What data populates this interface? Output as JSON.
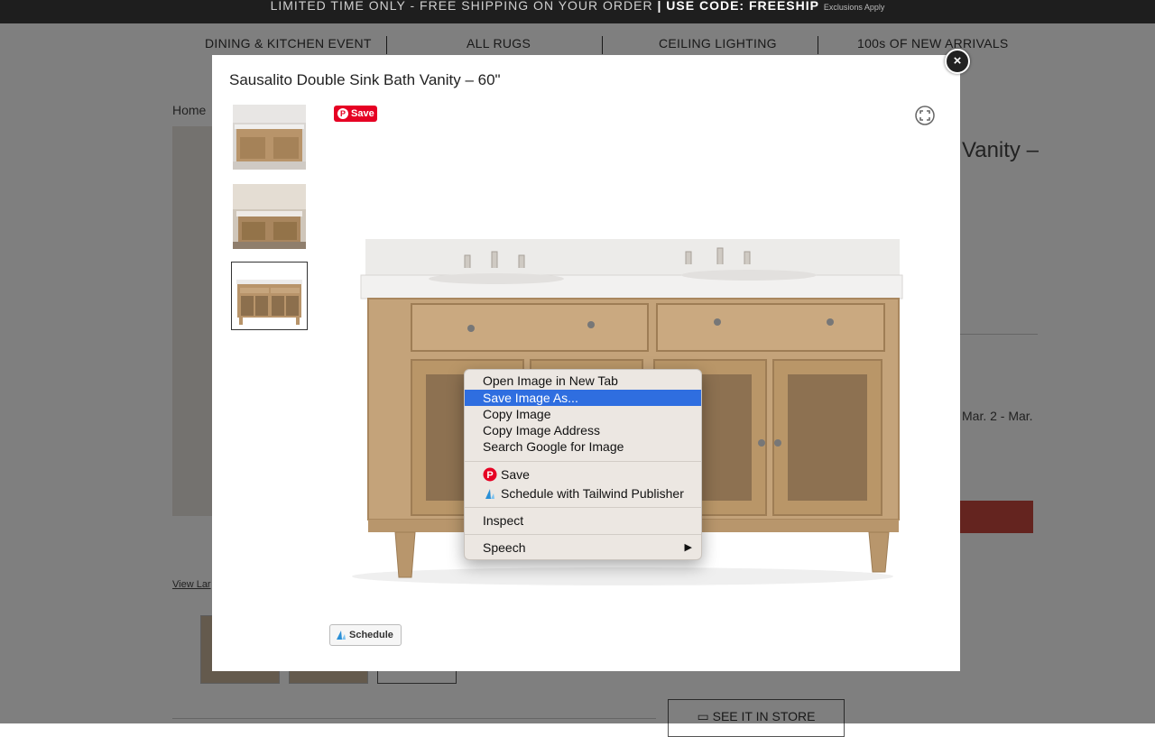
{
  "promo": {
    "text": "LIMITED TIME ONLY - FREE SHIPPING ON YOUR ORDER",
    "code": "| USE CODE: FREESHIP",
    "note": "Exclusions Apply"
  },
  "nav": {
    "items": [
      {
        "label": "DINING & KITCHEN EVENT"
      },
      {
        "label": "ALL RUGS"
      },
      {
        "label": "CEILING LIGHTING"
      },
      {
        "label": "100s OF NEW ARRIVALS"
      }
    ]
  },
  "page": {
    "breadcrumb_home": "Home",
    "title_fragment": "Vanity –",
    "delivery_fragment": "Mar. 2 - Mar.",
    "view_larger": "View Lar",
    "see_in_store": "SEE IT IN STORE"
  },
  "modal": {
    "title": "Sausalito Double Sink Bath Vanity – 60\"",
    "pin_save_label": "Save",
    "pin_glyph": "P",
    "schedule_label": "Schedule",
    "close_glyph": "×"
  },
  "context_menu": {
    "items": [
      {
        "label": "Open Image in New Tab"
      },
      {
        "label": "Save Image As..."
      },
      {
        "label": "Copy Image"
      },
      {
        "label": "Copy Image Address"
      },
      {
        "label": "Search Google for Image"
      },
      {
        "label": "Save"
      },
      {
        "label": "Schedule with Tailwind Publisher"
      },
      {
        "label": "Inspect"
      },
      {
        "label": "Speech"
      }
    ],
    "submenu_arrow": "▶",
    "highlighted_index": 1,
    "highlight_color": "#2f6ee0"
  },
  "icons": {
    "pinterest": "pinterest-icon",
    "tailwind": "tailwind-icon",
    "fullscreen": "fullscreen-icon",
    "close": "close-icon"
  },
  "colors": {
    "pinterest_red": "#e60023",
    "promo_bar": "#1e1e1e",
    "cta_red": "#c8483f"
  }
}
